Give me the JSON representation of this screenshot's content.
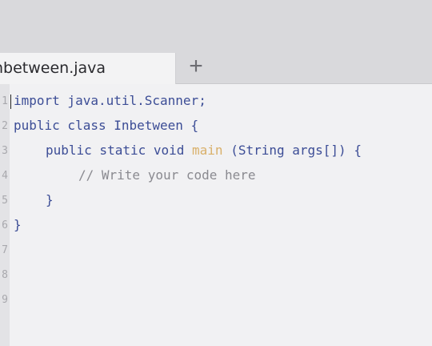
{
  "tab": {
    "label": "nbetween.java",
    "add_label": "+"
  },
  "editor": {
    "lines": [
      {
        "num": "1",
        "text": "import java.util.Scanner;"
      },
      {
        "num": "2",
        "text": "public class Inbetween {"
      },
      {
        "num": "3",
        "kw": "public static void ",
        "fn": "main",
        "rest": " (String args[]) {"
      },
      {
        "num": "4",
        "text": "// Write your code here"
      },
      {
        "num": "5",
        "text": "}"
      },
      {
        "num": "6",
        "text": "}"
      },
      {
        "num": "7",
        "text": ""
      },
      {
        "num": "8",
        "text": ""
      },
      {
        "num": "9",
        "text": ""
      }
    ]
  },
  "colors": {
    "keyword": "#3c4d96",
    "method": "#d9b06a",
    "comment": "#8a8a90",
    "background": "#f1f1f3"
  }
}
